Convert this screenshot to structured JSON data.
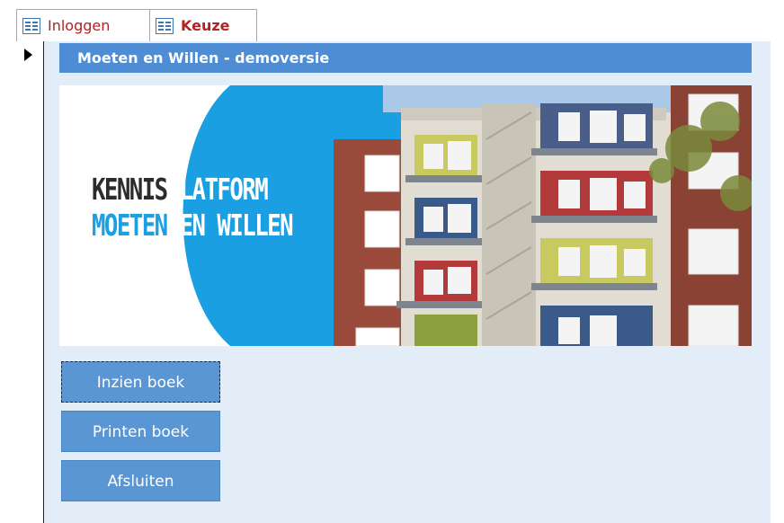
{
  "tabs": [
    {
      "label": "Inloggen",
      "icon": "form-icon",
      "active": false
    },
    {
      "label": "Keuze",
      "icon": "form-icon",
      "active": true
    }
  ],
  "form": {
    "title": "Moeten en Willen - demoversie",
    "banner": {
      "line1_dark": "KENNIS",
      "line1_light": "PLATFORM",
      "line2_blue": "MOETEN",
      "line2_white": "EN WILLEN"
    },
    "buttons": {
      "view": "Inzien boek",
      "print": "Printen boek",
      "close": "Afsluiten"
    }
  },
  "colors": {
    "accent": "#4e8cd4",
    "button": "#5b96d4",
    "form_background": "#e3edf7",
    "tab_text": "#b22222",
    "brand_blue": "#1ca0e0"
  }
}
